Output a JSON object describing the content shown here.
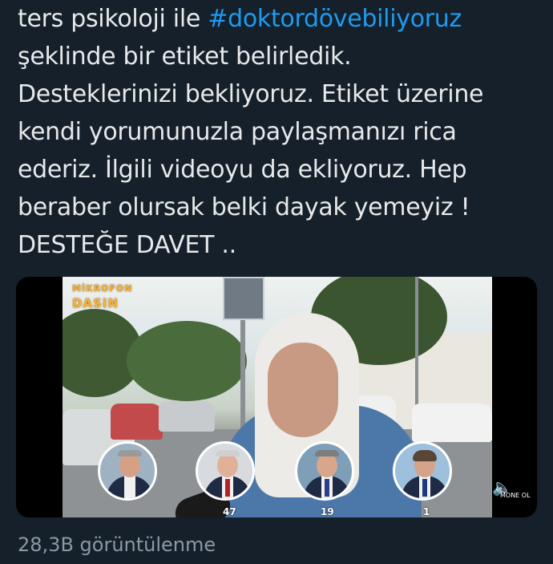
{
  "tweet": {
    "line1_pre": "ters psikoloji ile ",
    "hashtag": "#doktordövebiliyoruz",
    "rest": "şeklinde bir etiket belirledik.\nDesteklerinizi bekliyoruz. Etiket üzerine\nkendi yorumunuzla paylaşmanızı rica\nederiz. İlgili videoyu da ekliyoruz. Hep\nberaber olursak belki dayak yemeyiz !\nDESTEĞE DAVET .."
  },
  "media": {
    "logo_line1": "MİKROFON",
    "logo_line2": "DASIN",
    "candidates": [
      {
        "icon": "politician-avatar-1",
        "count": ""
      },
      {
        "icon": "politician-avatar-2",
        "count": "47"
      },
      {
        "icon": "politician-avatar-3",
        "count": "19"
      },
      {
        "icon": "politician-avatar-4",
        "count": "1"
      }
    ],
    "mute_icon": "speaker-icon",
    "watermark": "MONE OL"
  },
  "footer": {
    "views": "28,3B görüntülenme"
  },
  "colors": {
    "background": "#15202b",
    "text": "#e7e9ea",
    "hashtag": "#1d9bf0",
    "secondary": "#8b98a5"
  }
}
